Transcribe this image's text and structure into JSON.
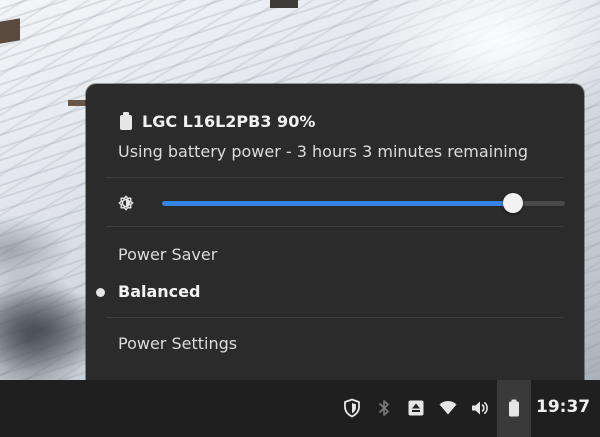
{
  "battery": {
    "title": "LGC L16L2PB3 90%",
    "status": "Using battery power - 3 hours 3 minutes remaining"
  },
  "brightness": {
    "level": 0.87
  },
  "power_modes": {
    "items": [
      {
        "label": "Power Saver",
        "selected": false
      },
      {
        "label": "Balanced",
        "selected": true
      }
    ]
  },
  "power_settings_label": "Power Settings",
  "tray": {
    "icons": [
      "shield-icon",
      "bluetooth-icon",
      "eject-icon",
      "wifi-icon",
      "volume-icon",
      "battery-icon"
    ],
    "time": "19:37"
  },
  "colors": {
    "accent": "#3584e4",
    "popover_bg": "#2b2b2b",
    "panel_bg": "#1f1f1f"
  }
}
